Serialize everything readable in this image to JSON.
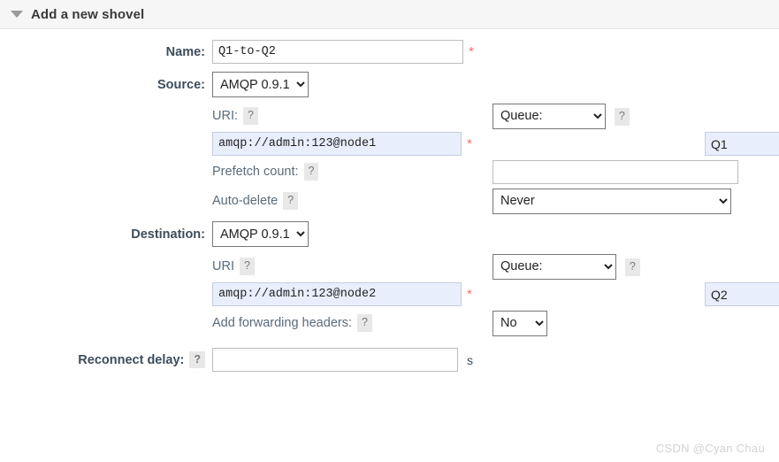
{
  "header": {
    "title": "Add a new shovel",
    "disclosure_icon": "triangle-down-icon"
  },
  "form": {
    "name": {
      "label": "Name:",
      "value": "Q1-to-Q2",
      "placeholder": "",
      "required_marker": "*"
    },
    "source": {
      "label": "Source:",
      "protocol_selected": "AMQP 0.9.1",
      "uri": {
        "label": "URI:",
        "help": "?",
        "value": "amqp://admin:123@node1",
        "placeholder": "",
        "required_marker": "*"
      },
      "target": {
        "selected": "Queue:",
        "help": "?",
        "value": "Q1",
        "placeholder": ""
      },
      "prefetch": {
        "label": "Prefetch count:",
        "help": "?",
        "value": "",
        "placeholder": ""
      },
      "auto_delete": {
        "label": "Auto-delete",
        "help": "?",
        "selected": "Never"
      }
    },
    "destination": {
      "label": "Destination:",
      "protocol_selected": "AMQP 0.9.1",
      "uri": {
        "label": "URI",
        "help": "?",
        "value": "amqp://admin:123@node2",
        "placeholder": "",
        "required_marker": "*"
      },
      "target": {
        "selected": "Queue:",
        "help": "?",
        "value": "Q2",
        "placeholder": ""
      },
      "forwarding_headers": {
        "label": "Add forwarding headers:",
        "help": "?",
        "selected": "No"
      }
    },
    "reconnect_delay": {
      "label": "Reconnect delay:",
      "help": "?",
      "value": "",
      "placeholder": "",
      "unit": "s"
    }
  },
  "watermark": "CSDN @Cyan Chau",
  "colors": {
    "header_bg": "#f6f6f6",
    "label": "#3d4c5c",
    "sublabel": "#5a6b7b",
    "required": "#ff6b6b",
    "filled_input_bg": "#e8eefb",
    "help_chip_bg": "#e8e8e8"
  }
}
